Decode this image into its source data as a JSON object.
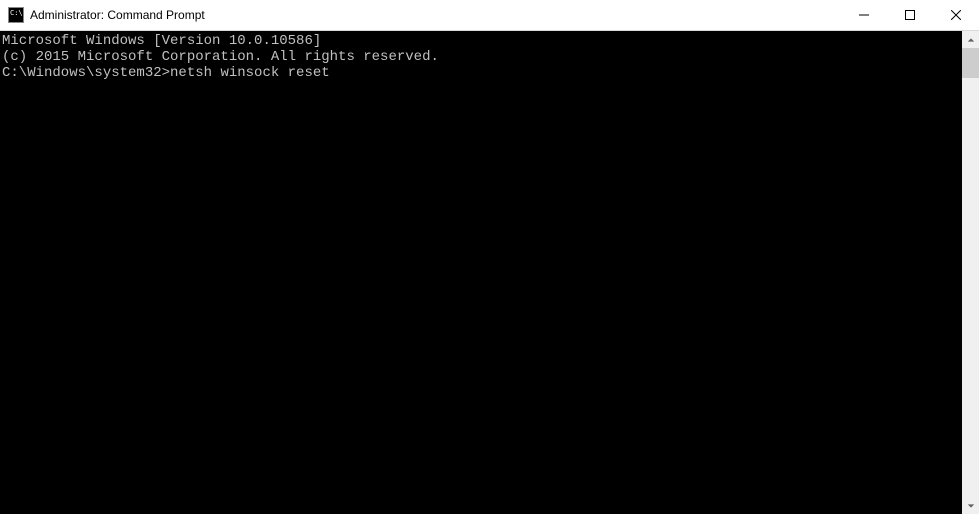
{
  "window": {
    "title": "Administrator: Command Prompt"
  },
  "terminal": {
    "line1": "Microsoft Windows [Version 10.0.10586]",
    "line2": "(c) 2015 Microsoft Corporation. All rights reserved.",
    "blank": "",
    "prompt": "C:\\Windows\\system32>",
    "command": "netsh winsock reset"
  }
}
